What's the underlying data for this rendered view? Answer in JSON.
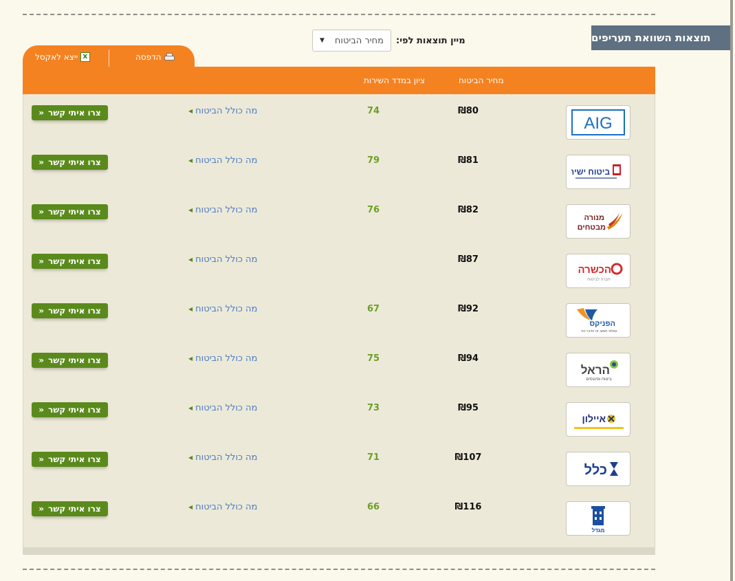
{
  "results_title": "תוצאות השוואת תעריפים",
  "sort": {
    "label": "מיין תוצאות לפי:",
    "selected": "מחיר הביטוח"
  },
  "toolbar": {
    "excel_label": "ייצא לאקסל",
    "print_label": "הדפסה"
  },
  "table": {
    "columns": {
      "price": "מחיר הביטוח",
      "score": "ציון במדד השירות"
    },
    "button_label": "צרו איתי קשר",
    "coverage_label": "מה כולל הביטוח",
    "rows": [
      {
        "company": "AIG",
        "logo_text": "AIG",
        "price": "₪80",
        "score": "74"
      },
      {
        "company": "Bituah Yashir",
        "logo_text": "ביטוח ישיר",
        "price": "₪81",
        "score": "79"
      },
      {
        "company": "Menora Mivtachim",
        "logo_text": "מנורה מבטחים",
        "price": "₪82",
        "score": "76"
      },
      {
        "company": "Hachshara",
        "logo_text": "הכשרה",
        "price": "₪87",
        "score": ""
      },
      {
        "company": "Phoenix",
        "logo_text": "הפניקס",
        "price": "₪92",
        "score": "67"
      },
      {
        "company": "Harel",
        "logo_text": "הראל",
        "price": "₪94",
        "score": "75"
      },
      {
        "company": "Ayalon",
        "logo_text": "איילון",
        "price": "₪95",
        "score": "73"
      },
      {
        "company": "Clal",
        "logo_text": "כלל",
        "price": "₪107",
        "score": "71"
      },
      {
        "company": "Migdal",
        "logo_text": "מגדל",
        "price": "₪116",
        "score": "66"
      }
    ]
  },
  "colors": {
    "accent": "#f58220",
    "button": "#5a8a1c",
    "score": "#6aa028",
    "link": "#4a7cc0",
    "title_bg": "#5e7081"
  }
}
